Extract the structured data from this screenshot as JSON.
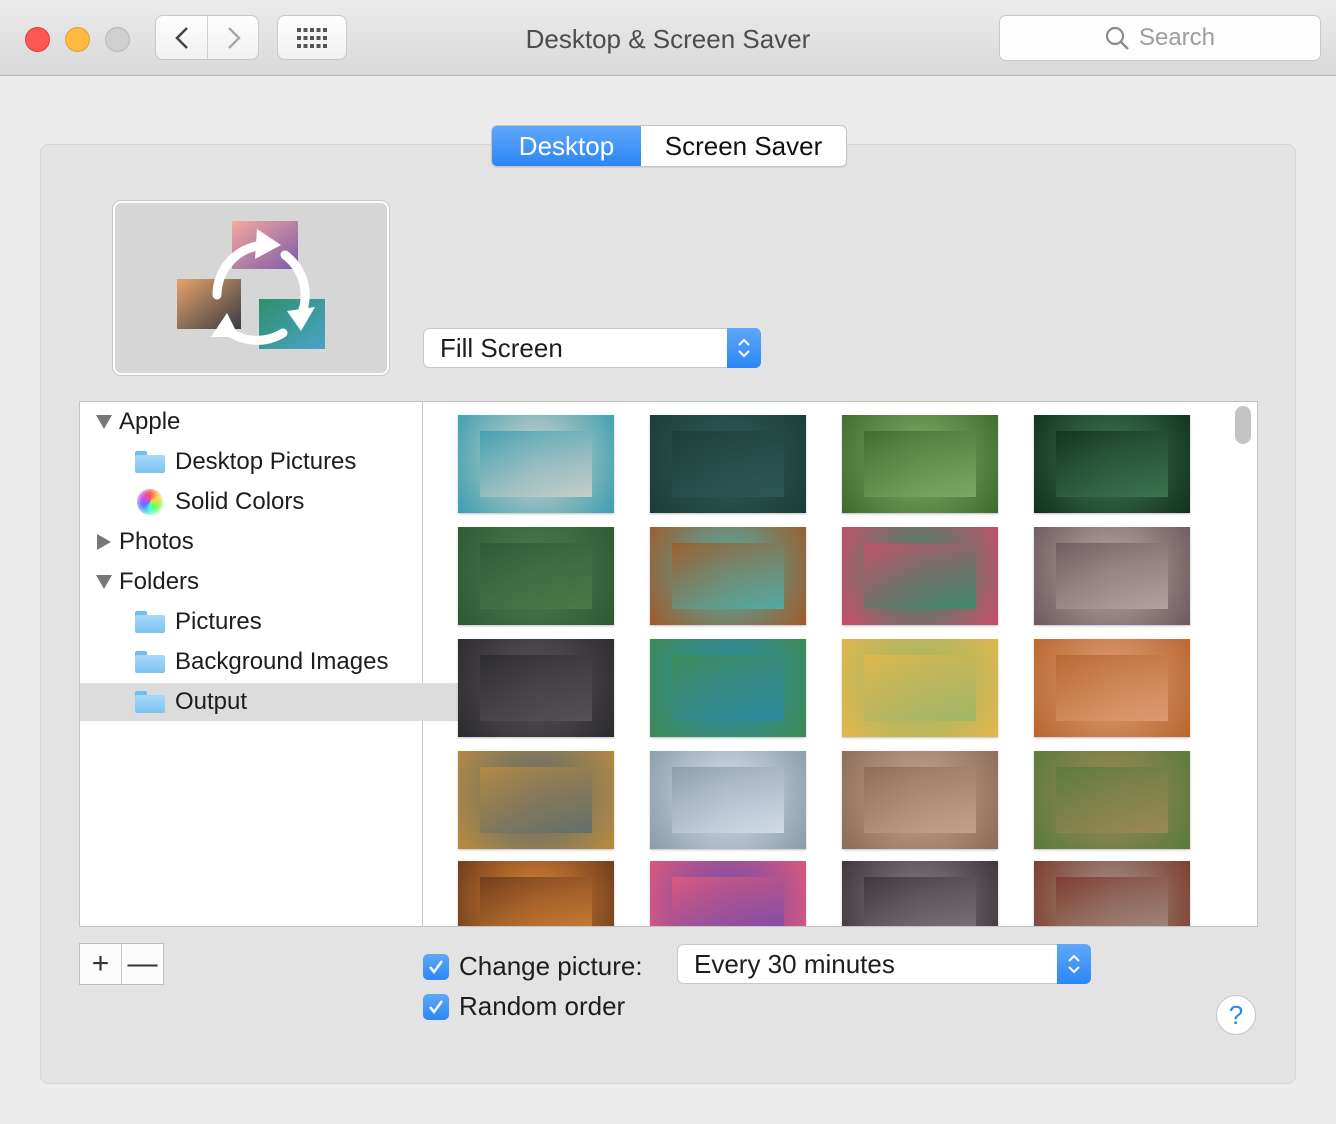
{
  "window": {
    "title": "Desktop & Screen Saver"
  },
  "search": {
    "placeholder": "Search"
  },
  "tabs": [
    {
      "label": "Desktop",
      "selected": true
    },
    {
      "label": "Screen Saver",
      "selected": false
    }
  ],
  "fit_popup": {
    "value": "Fill Screen"
  },
  "sidebar": {
    "items": [
      {
        "label": "Apple",
        "kind": "group",
        "expanded": true
      },
      {
        "label": "Desktop Pictures",
        "kind": "folder-icon"
      },
      {
        "label": "Solid Colors",
        "kind": "color-wheel-icon"
      },
      {
        "label": "Photos",
        "kind": "group",
        "expanded": false
      },
      {
        "label": "Folders",
        "kind": "group",
        "expanded": true
      },
      {
        "label": "Pictures",
        "kind": "pictures-folder-icon"
      },
      {
        "label": "Background Images",
        "kind": "folder-icon"
      },
      {
        "label": "Output",
        "kind": "folder-icon",
        "selected": true
      }
    ]
  },
  "thumbnails": [
    [
      "#d8d2cc",
      "#3a9fb0"
    ],
    [
      "#2f5a55",
      "#1c3d3a"
    ],
    [
      "#7fb06a",
      "#3e6b2c"
    ],
    [
      "#3f7a55",
      "#12311f"
    ],
    [
      "#4f7d4c",
      "#2d5a34"
    ],
    [
      "#49b3b0",
      "#a05a2a"
    ],
    [
      "#2e8f6e",
      "#c94d6a"
    ],
    [
      "#b9aaa6",
      "#6b5a5c"
    ],
    [
      "#5a5558",
      "#2c2b30"
    ],
    [
      "#2c8cab",
      "#3f8a55"
    ],
    [
      "#9ab76a",
      "#e2b64d"
    ],
    [
      "#e0a07a",
      "#b8652d"
    ],
    [
      "#5a6b70",
      "#b88a40"
    ],
    [
      "#d8e2ec",
      "#8a9aa8"
    ],
    [
      "#c8a890",
      "#8a6b58"
    ],
    [
      "#a08a5a",
      "#5a7a3a"
    ],
    [
      "#e08a3a",
      "#6b3a1a"
    ],
    [
      "#6a4ab0",
      "#e05a7a"
    ],
    [
      "#8a8088",
      "#3a3438"
    ],
    [
      "#a89890",
      "#7a3a2a"
    ]
  ],
  "bottom": {
    "change_picture_label": "Change picture:",
    "interval_value": "Every 30 minutes",
    "random_order_label": "Random order",
    "add_symbol": "+",
    "remove_symbol": "—",
    "help_symbol": "?"
  }
}
